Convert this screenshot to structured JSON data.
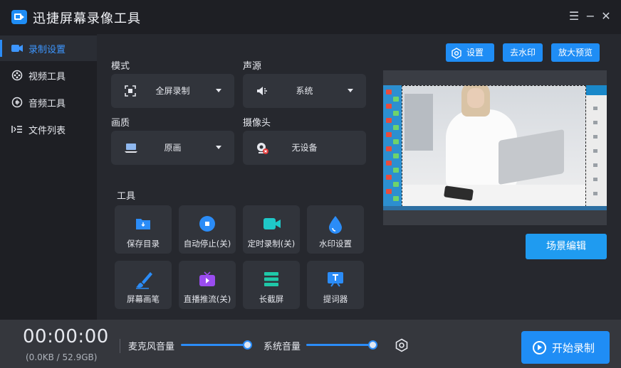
{
  "app": {
    "title": "迅捷屏幕录像工具"
  },
  "window_controls": {
    "menu": "☰",
    "minimize": "−",
    "close": "✕"
  },
  "sidebar": {
    "items": [
      {
        "label": "录制设置",
        "icon": "camera-icon",
        "active": true
      },
      {
        "label": "视频工具",
        "icon": "film-icon",
        "active": false
      },
      {
        "label": "音频工具",
        "icon": "audio-icon",
        "active": false
      },
      {
        "label": "文件列表",
        "icon": "list-icon",
        "active": false
      }
    ]
  },
  "settings": {
    "mode": {
      "label": "模式",
      "value": "全屏录制",
      "icon": "fullscreen-icon"
    },
    "audio_source": {
      "label": "声源",
      "value": "系统",
      "icon": "speaker-icon"
    },
    "quality": {
      "label": "画质",
      "value": "原画",
      "icon": "laptop-icon"
    },
    "camera": {
      "label": "摄像头",
      "value": "无设备",
      "icon": "webcam-icon"
    }
  },
  "tools": {
    "label": "工具",
    "items": [
      {
        "label": "保存目录",
        "icon": "folder-icon"
      },
      {
        "label": "自动停止(关)",
        "icon": "stop-icon"
      },
      {
        "label": "定时录制(关)",
        "icon": "video-camera-icon"
      },
      {
        "label": "水印设置",
        "icon": "drop-icon"
      },
      {
        "label": "屏幕画笔",
        "icon": "brush-icon"
      },
      {
        "label": "直播推流(关)",
        "icon": "tv-icon"
      },
      {
        "label": "长截屏",
        "icon": "stack-icon"
      },
      {
        "label": "提词器",
        "icon": "teleprompter-icon"
      }
    ]
  },
  "top_buttons": {
    "settings": "设置",
    "remove_watermark": "去水印",
    "enlarge_preview": "放大预览"
  },
  "scene_edit": "场景编辑",
  "status": {
    "timer": "00:00:00",
    "sizes": "(0.0KB / 52.9GB)"
  },
  "volume": {
    "mic_label": "麦克风音量",
    "mic_level": 1.0,
    "system_label": "系统音量",
    "system_level": 1.0
  },
  "start_button": "开始录制",
  "colors": {
    "accent": "#1f8df5",
    "active_nav": "#3d96ff",
    "panel": "#26282e",
    "card": "#31343b"
  }
}
